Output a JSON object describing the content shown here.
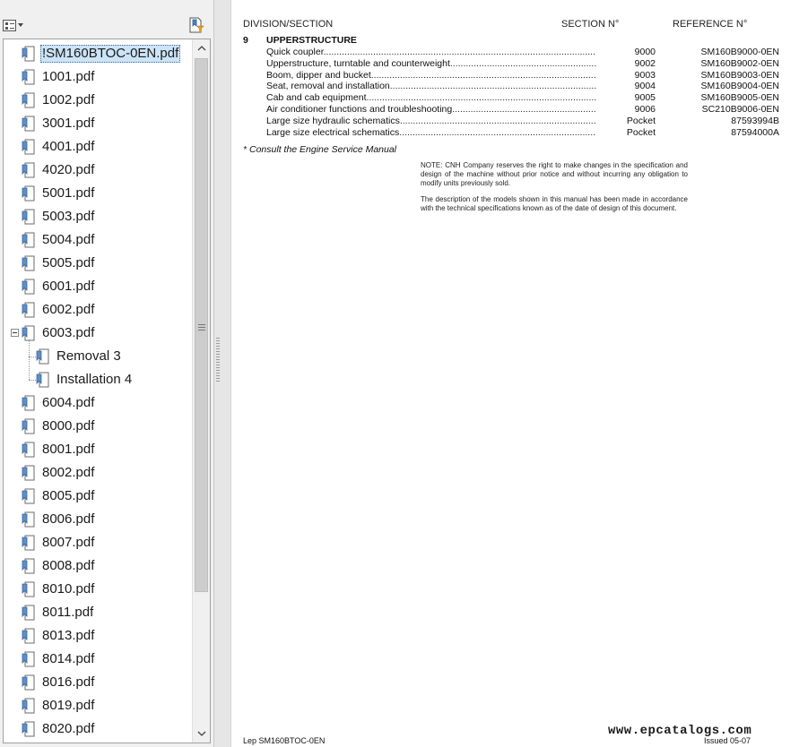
{
  "bookmarks": {
    "items": [
      {
        "label": "!SM160BTOC-0EN.pdf",
        "level": 0,
        "selected": true
      },
      {
        "label": "1001.pdf",
        "level": 0
      },
      {
        "label": "1002.pdf",
        "level": 0
      },
      {
        "label": "3001.pdf",
        "level": 0
      },
      {
        "label": "4001.pdf",
        "level": 0
      },
      {
        "label": "4020.pdf",
        "level": 0
      },
      {
        "label": "5001.pdf",
        "level": 0
      },
      {
        "label": "5003.pdf",
        "level": 0
      },
      {
        "label": "5004.pdf",
        "level": 0
      },
      {
        "label": "5005.pdf",
        "level": 0
      },
      {
        "label": "6001.pdf",
        "level": 0
      },
      {
        "label": "6002.pdf",
        "level": 0
      },
      {
        "label": "6003.pdf",
        "level": 0,
        "expanded": true
      },
      {
        "label": "Removal 3",
        "level": 1
      },
      {
        "label": "Installation 4",
        "level": 1
      },
      {
        "label": "6004.pdf",
        "level": 0
      },
      {
        "label": "8000.pdf",
        "level": 0
      },
      {
        "label": "8001.pdf",
        "level": 0
      },
      {
        "label": "8002.pdf",
        "level": 0
      },
      {
        "label": "8005.pdf",
        "level": 0
      },
      {
        "label": "8006.pdf",
        "level": 0
      },
      {
        "label": "8007.pdf",
        "level": 0
      },
      {
        "label": "8008.pdf",
        "level": 0
      },
      {
        "label": "8010.pdf",
        "level": 0
      },
      {
        "label": "8011.pdf",
        "level": 0
      },
      {
        "label": "8013.pdf",
        "level": 0
      },
      {
        "label": "8014.pdf",
        "level": 0
      },
      {
        "label": "8016.pdf",
        "level": 0
      },
      {
        "label": "8019.pdf",
        "level": 0
      },
      {
        "label": "8020.pdf",
        "level": 0
      }
    ]
  },
  "document": {
    "header": {
      "division": "DIVISION/SECTION",
      "section": "SECTION N°",
      "reference": "REFERENCE N°"
    },
    "section_number": "9",
    "section_title": "UPPERSTRUCTURE",
    "rows": [
      {
        "title": "Quick coupler",
        "section": "9000",
        "reference": "SM160B9000-0EN"
      },
      {
        "title": "Upperstructure, turntable and counterweight",
        "section": "9002",
        "reference": "SM160B9002-0EN"
      },
      {
        "title": "Boom, dipper and bucket",
        "section": "9003",
        "reference": "SM160B9003-0EN"
      },
      {
        "title": "Seat, removal and installation",
        "section": "9004",
        "reference": "SM160B9004-0EN"
      },
      {
        "title": "Cab and cab equipment",
        "section": "9005",
        "reference": "SM160B9005-0EN"
      },
      {
        "title": "Air conditioner functions and troubleshooting",
        "section": "9006",
        "reference": "SC210B9006-0EN"
      },
      {
        "title": "Large size hydraulic schematics",
        "section": "Pocket",
        "reference": "87593994B"
      },
      {
        "title": "Large size electrical schematics",
        "section": "Pocket",
        "reference": "87594000A"
      }
    ],
    "footnote": "*  Consult the Engine Service Manual",
    "note1": "NOTE: CNH Company reserves the right to make changes in the specification and design of the machine without prior notice and without incurring any obligation to modify units previously sold.",
    "note2": "The description of the models shown in this manual has been made in accordance with the technical specifications known as of the date of design of this document.",
    "footer_left": "Lep SM160BTOC-0EN",
    "footer_right": "Issued 05-07",
    "watermark": "www.epcatalogs.com"
  },
  "icons": {
    "options": "options-menu-icon",
    "new_bookmark": "new-bookmark-icon",
    "bookmark": "bookmark-icon",
    "collapse": "collapse-icon",
    "scroll_up": "scroll-up-arrow-icon",
    "scroll_down": "scroll-down-arrow-icon"
  },
  "colors": {
    "selection": "#cce4f7",
    "panel": "#f0f0f0"
  }
}
